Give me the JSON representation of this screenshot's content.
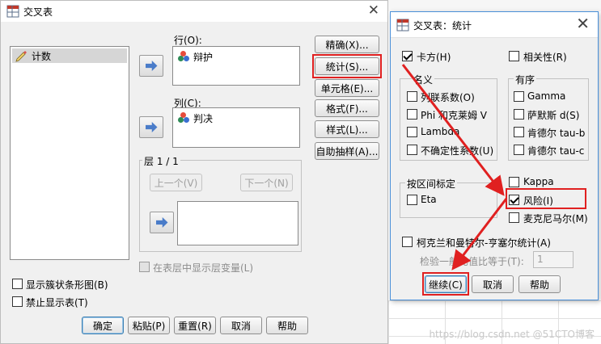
{
  "main_dialog": {
    "title": "交叉表",
    "close_glyph": "✕",
    "source_list": [
      {
        "label": "计数",
        "icon": "pencil-ruler-icon"
      }
    ],
    "rows_label": "行(O):",
    "rows_vars": [
      {
        "label": "辩护",
        "icon": "nominal-variable-icon"
      }
    ],
    "cols_label": "列(C):",
    "cols_vars": [
      {
        "label": "判决",
        "icon": "nominal-variable-icon"
      }
    ],
    "layer_label": "层 1 / 1",
    "prev_label": "上一个(V)",
    "next_label": "下一个(N)",
    "side_buttons": [
      "精确(X)...",
      "统计(S)...",
      "单元格(E)...",
      "格式(F)...",
      "样式(L)...",
      "自助抽样(A)..."
    ],
    "show_layer_vars": "在表层中显示层变量(L)",
    "show_bar_charts": "显示簇状条形图(B)",
    "suppress_tables": "禁止显示表(T)",
    "bottom_buttons": [
      "确定",
      "粘贴(P)",
      "重置(R)",
      "取消",
      "帮助"
    ]
  },
  "stats_dialog": {
    "title": "交叉表：统计",
    "close_glyph": "✕",
    "chi_square": {
      "label": "卡方(H)",
      "checked": true
    },
    "correlations": {
      "label": "相关性(R)",
      "checked": false
    },
    "nominal": {
      "title": "名义",
      "items": [
        "列联系数(O)",
        "Phi 和克莱姆 V",
        "Lambda",
        "不确定性系数(U)"
      ]
    },
    "ordinal": {
      "title": "有序",
      "items": [
        "Gamma",
        "萨默斯 d(S)",
        "肯德尔 tau-b",
        "肯德尔 tau-c"
      ]
    },
    "interval": {
      "title": "按区间标定",
      "items": [
        "Eta"
      ]
    },
    "kappa": {
      "label": "Kappa",
      "checked": false
    },
    "risk": {
      "label": "风险(I)",
      "checked": true
    },
    "mcnemar": {
      "label": "麦克尼马尔(M)",
      "checked": false
    },
    "cmh": {
      "label": "柯克兰和曼特尔-亨塞尔统计(A)",
      "checked": false
    },
    "odds_ratio_label": "检验一般比值比等于(T):",
    "odds_ratio_value": "1",
    "buttons": [
      "继续(C)",
      "取消",
      "帮助"
    ]
  },
  "watermark": "https://blog.csdn.net @51CTO博客",
  "colors": {
    "annotation_red": "#e02020",
    "accent_blue": "#4a7cc9"
  }
}
